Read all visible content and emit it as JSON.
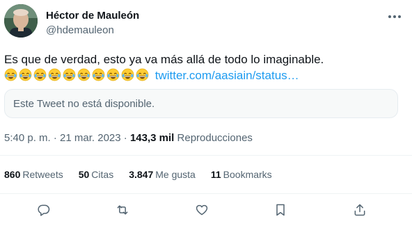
{
  "author": {
    "name": "Héctor de Mauleón",
    "handle": "@hdemauleon"
  },
  "tweet": {
    "text": "Es que de verdad, esto ya va más allá de todo lo imaginable.",
    "emoji_name": "face-with-tears-of-joy",
    "emoji_count": 10,
    "link_text": "twitter.com/aasiain/status…"
  },
  "quoted": {
    "unavailable_text": "Este Tweet no está disponible."
  },
  "meta": {
    "time": "5:40 p. m.",
    "separator1": "·",
    "date": "21 mar. 2023",
    "separator2": "·",
    "views_count": "143,3 mil",
    "views_label": "Reproducciones"
  },
  "stats": {
    "retweets_count": "860",
    "retweets_label": "Retweets",
    "quotes_count": "50",
    "quotes_label": "Citas",
    "likes_count": "3.847",
    "likes_label": "Me gusta",
    "bookmarks_count": "11",
    "bookmarks_label": "Bookmarks"
  },
  "icons": {
    "reply": "reply-icon",
    "retweet": "retweet-icon",
    "like": "heart-icon",
    "bookmark": "bookmark-icon",
    "share": "share-icon",
    "more": "more-dots-icon"
  },
  "colors": {
    "link": "#1d9bf0",
    "secondary_text": "#536471",
    "primary_text": "#0f1419"
  }
}
